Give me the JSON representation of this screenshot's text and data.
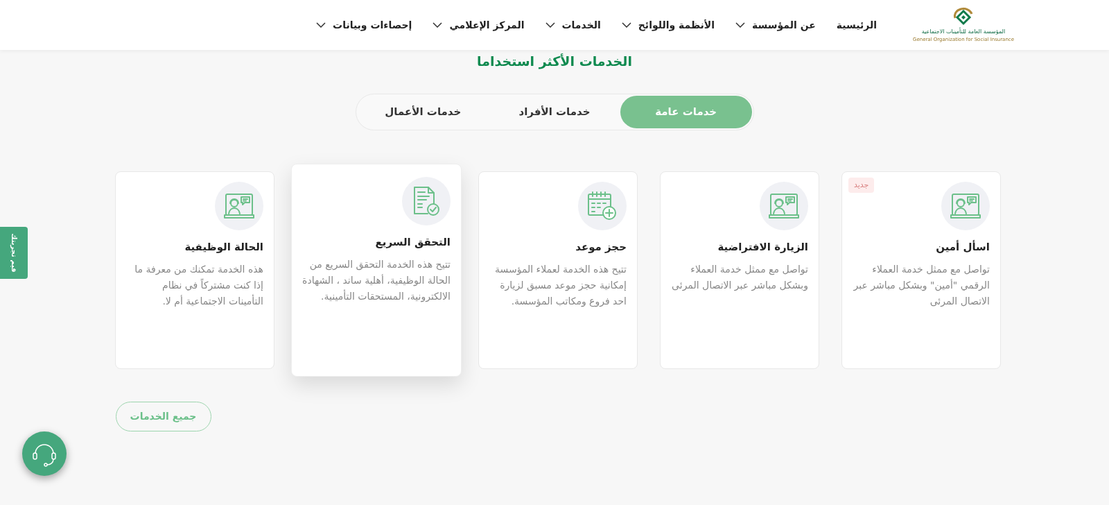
{
  "header": {
    "logo": {
      "name_ar": "المؤسسة العامة للتأمينات الاجتماعية",
      "name_en": "General Organization for Social Insurance"
    },
    "nav": [
      {
        "label": "الرئيسية",
        "has_dropdown": false
      },
      {
        "label": "عن المؤسسة",
        "has_dropdown": true
      },
      {
        "label": "الأنظمة واللوائح",
        "has_dropdown": true
      },
      {
        "label": "الخدمات",
        "has_dropdown": true
      },
      {
        "label": "المركز الإعلامي",
        "has_dropdown": true
      },
      {
        "label": "إحصاءات وبيانات",
        "has_dropdown": true
      }
    ]
  },
  "section": {
    "title": "الخدمات الأكثر استخداما",
    "tabs": [
      {
        "label": "خدمات عامة",
        "selected": true
      },
      {
        "label": "خدمات الأفراد",
        "selected": false
      },
      {
        "label": "خدمات الأعمال",
        "selected": false
      }
    ],
    "cards": [
      {
        "title": "اسأل أمين",
        "description": "تواصل مع ممثل خدمة العملاء الرقمي \"أمين\" وبشكل مباشر عبر الاتصال المرئى",
        "kind": "agent",
        "badge": "جديد",
        "highlighted": false
      },
      {
        "title": "الزيارة الافتراضية",
        "description": "تواصل مع ممثل خدمة العملاء وبشكل مباشر عبر الاتصال المرئى",
        "kind": "agent",
        "highlighted": false
      },
      {
        "title": "حجز موعد",
        "description": "تتيح هذه الخدمة لعملاء المؤسسة إمكانية حجز موعد مسبق لزيارة احد فروع ومكاتب المؤسسة.",
        "kind": "calendar",
        "highlighted": false
      },
      {
        "title": "التحقق السريع",
        "description": "تتيح هذه الخدمة التحقق السريع من الحالة الوظيفية، أهلية ساند ، الشهادة الالكترونية، المستحقات التأمينية.",
        "kind": "document",
        "highlighted": true
      },
      {
        "title": "الحالة الوظيفية",
        "description": "هذه الخدمة تمكنك من معرفة ما إذا كنت مشتركاً في نظام التأمينات الاجتماعية أم لا.",
        "kind": "agent",
        "highlighted": false
      }
    ],
    "all_button": "جميع الخدمات"
  },
  "feedback_tab": "قيم تجربتك"
}
